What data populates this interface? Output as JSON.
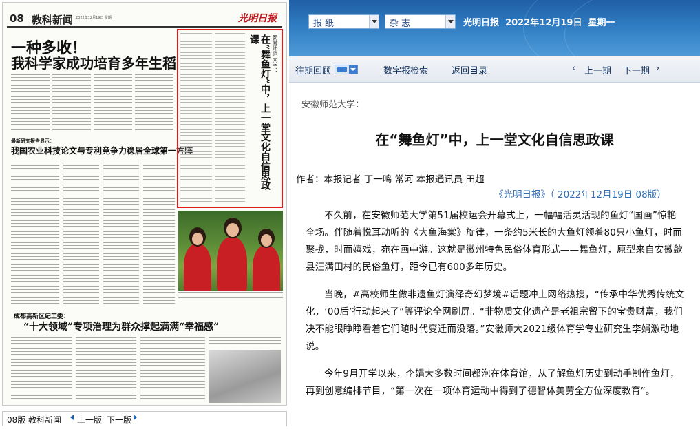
{
  "paper_page": {
    "page_number": "08",
    "section": "教科新闻",
    "masthead": "光明日报",
    "date_small": "2022年12月19日 星期一",
    "headline_main_1": "一种多收！",
    "headline_main_2": "我科学家成功培育多年生稻",
    "sub_kicker_1": "最新研究报告显示：",
    "headline_3": "我国农业科技论文与专利竞争力稳居全球第一方阵",
    "sub_kicker_2": "成都高新区纪工委：",
    "headline_4": "“十大领域”专项治理为群众撑起满满“幸福感”",
    "selected_kicker": "安徽师范大学：",
    "selected_title": "在“舞鱼灯”中，上一堂文化自信思政课"
  },
  "bottom_nav": {
    "label": "08版 教科新闻",
    "prev": "上一版",
    "next": "下一版"
  },
  "top_bar": {
    "select_paper": "报纸",
    "select_magazine": "杂志",
    "paper_name": "光明日报",
    "date": "2022年12月19日",
    "weekday": "星期一"
  },
  "toolbar": {
    "history": "往期回顾",
    "digital_search": "数字报检索",
    "back_to_toc": "返回目录",
    "prev_issue": "上一期",
    "next_issue": "下一期"
  },
  "article": {
    "kicker": "安徽师范大学：",
    "title": "在“舞鱼灯”中，上一堂文化自信思政课",
    "author": "作者：本报记者  丁一鸣  常河  本报通讯员  田超",
    "source": "《光明日报》（ 2022年12月19日   08版）",
    "paragraphs": [
      "不久前，在安徽师范大学第51届校运会开幕式上，一幅幅活灵活现的鱼灯“国画”惊艳全场。伴随着悦耳动听的《大鱼海棠》旋律，一条约5米长的大鱼灯领着80只小鱼灯，时而聚拢，时而嬉戏，宛在画中游。这就是徽州特色民俗体育形式——舞鱼灯，原型来自安徽歙县汪满田村的民俗鱼灯，距今已有600多年历史。",
      "当晚，#高校师生做非遗鱼灯演绎奇幻梦境#话题冲上网络热搜，“传承中华优秀传统文化，‘00后’行动起来了”等评论全网刷屏。“非物质文化遗产是老祖宗留下的宝贵财富，我们决不能眼睁睁看着它们随时代变迁而没落。”安徽师大2021级体育学专业研究生李娟激动地说。",
      "今年9月开学以来，李娟大多数时间都泡在体育馆，从了解鱼灯历史到动手制作鱼灯，再到创意编排节目，“第一次在一项体育运动中得到了德智体美劳全方位深度教育”。"
    ]
  },
  "colors": {
    "top_bar_blue": "#2f7cc2",
    "selection_red": "#e31b1b",
    "link_blue": "#2f6db5",
    "masthead_red": "#c0161d"
  }
}
